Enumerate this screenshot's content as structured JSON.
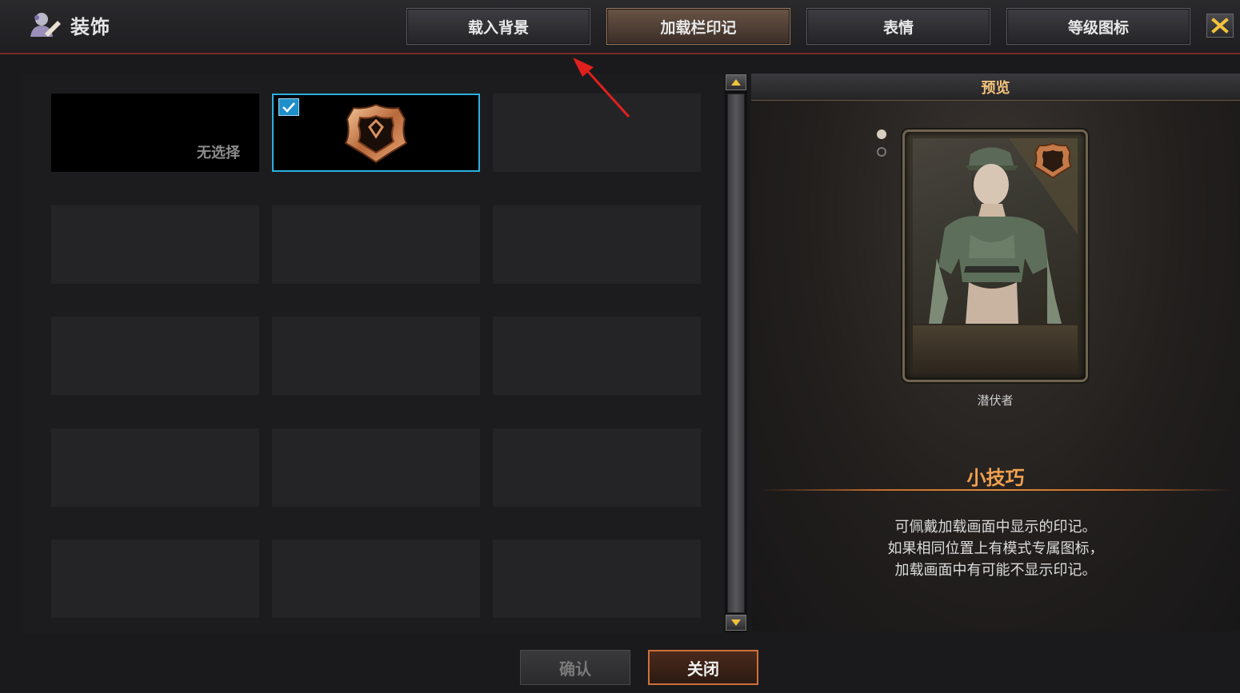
{
  "header": {
    "title": "装饰",
    "tabs": [
      {
        "label": "载入背景",
        "active": false
      },
      {
        "label": "加载栏印记",
        "active": true
      },
      {
        "label": "表情",
        "active": false
      },
      {
        "label": "等级图标",
        "active": false
      }
    ],
    "close_icon": "close-x-icon"
  },
  "grid": {
    "slots": [
      {
        "label": "无选择",
        "state": "empty-option"
      },
      {
        "label": "",
        "state": "selected",
        "icon": "shield-emblem-icon"
      },
      {
        "label": "",
        "state": "empty"
      }
    ]
  },
  "preview": {
    "header": "预览",
    "character_name": "潜伏者",
    "tips_title": "小技巧",
    "tips_lines": [
      "可佩戴加载画面中显示的印记。",
      "如果相同位置上有模式专属图标，",
      "加载画面中有可能不显示印记。"
    ]
  },
  "footer": {
    "confirm_label": "确认",
    "close_label": "关闭"
  },
  "colors": {
    "accent_selected": "#2ab0e0",
    "tips_title": "#f0a050",
    "preview_header": "#f2c27a",
    "close_button_border": "#d0703a"
  }
}
